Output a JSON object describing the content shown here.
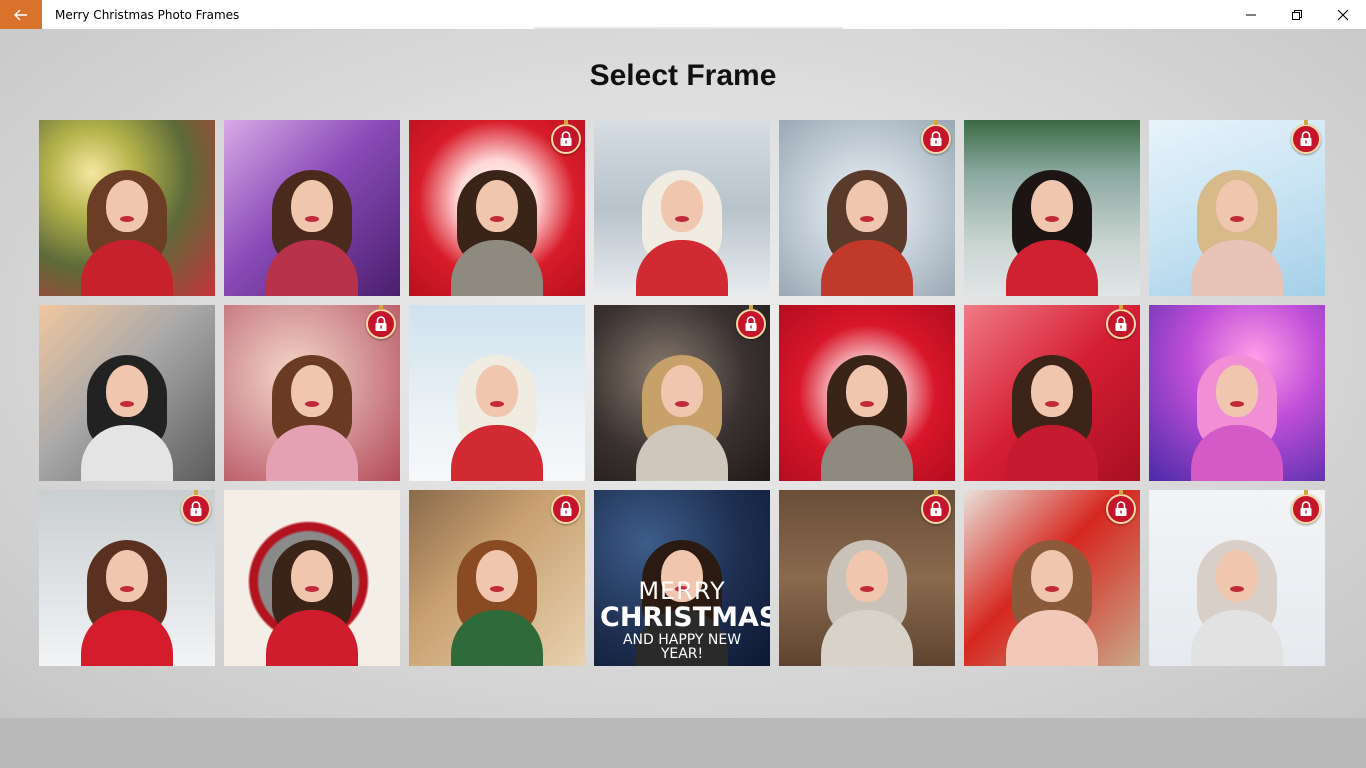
{
  "window": {
    "title": "Merry Christmas Photo Frames",
    "back_icon": "back-arrow-icon",
    "accent": "#d9732c"
  },
  "page": {
    "title": "Select Frame"
  },
  "frames": [
    {
      "id": "frame-1",
      "locked": false,
      "bg": "radial-gradient(circle at 30% 30%, #f6e7a0 0%, #b4b34a 25%, #5d6a3a 55%, #c4343a 100%)",
      "body": "#c8212e",
      "hair": "#6b3d24"
    },
    {
      "id": "frame-2",
      "locked": false,
      "bg": "linear-gradient(135deg, #d9a9e6 0%, #8a4cb8 45%, #4a1e6e 100%)",
      "body": "#b8324a",
      "hair": "#4a2a1c"
    },
    {
      "id": "frame-3",
      "locked": true,
      "bg": "radial-gradient(circle at 50% 45%, #ffffff 0%, #ffd7d7 30%, #d81c2a 60%, #b8101f 100%)",
      "body": "#8f8a80",
      "hair": "#3a2418"
    },
    {
      "id": "frame-4",
      "locked": false,
      "bg": "linear-gradient(180deg, #d6dde3 0%, #b8c3cc 50%, #e8ecef 100%)",
      "body": "#d22a32",
      "hair": "#f1ece2"
    },
    {
      "id": "frame-5",
      "locked": true,
      "bg": "radial-gradient(circle at 50% 50%, #f2f5f8 0%, #c8d3dc 45%, #9aa8b3 100%)",
      "body": "#c0392b",
      "hair": "#5a3a2a"
    },
    {
      "id": "frame-6",
      "locked": false,
      "bg": "linear-gradient(180deg, #3a6a44 0%, #8aa8a0 30%, #c9d4d0 70%, #e0e6e6 100%)",
      "body": "#cf2131",
      "hair": "#1d1414"
    },
    {
      "id": "frame-7",
      "locked": true,
      "bg": "linear-gradient(160deg, #e8f3fb 0%, #c9e4f3 50%, #a5cfe8 100%)",
      "body": "#e8c4b8",
      "hair": "#d7b98a"
    },
    {
      "id": "frame-8",
      "locked": false,
      "bg": "linear-gradient(135deg, #f1c7a0 0%, #a8a8a8 45%, #5c5c5c 100%)",
      "body": "#e4e4e4",
      "hair": "#222222"
    },
    {
      "id": "frame-9",
      "locked": true,
      "bg": "radial-gradient(circle at 40% 40%, #f5d7c8 0%, #d9a0a0 40%, #b34a5a 100%)",
      "body": "#e5a1b4",
      "hair": "#6b3a22"
    },
    {
      "id": "frame-10",
      "locked": false,
      "bg": "linear-gradient(180deg, #cfe2ee 0%, #eaf1f5 60%, #f6f8fa 100%)",
      "body": "#d22a32",
      "hair": "#f1ece2"
    },
    {
      "id": "frame-11",
      "locked": true,
      "bg": "radial-gradient(circle at 40% 40%, #8a7c70 0%, #3a3230 55%, #1e1a18 100%)",
      "body": "#d0c7bc",
      "hair": "#c8a06a"
    },
    {
      "id": "frame-12",
      "locked": false,
      "bg": "radial-gradient(circle at 50% 50%, #ffffff 0%, #ffe8e8 20%, #d8162a 55%, #b20d1f 100%)",
      "body": "#8f8a80",
      "hair": "#3a2418"
    },
    {
      "id": "frame-13",
      "locked": true,
      "bg": "linear-gradient(135deg, #f07b86 0%, #d51e33 50%, #a80f22 100%)",
      "body": "#c51a30",
      "hair": "#3c2418"
    },
    {
      "id": "frame-14",
      "locked": false,
      "bg": "radial-gradient(circle at 60% 30%, #ff9ee8 0%, #c04fd8 40%, #4a2aa8 100%)",
      "body": "#d45ac8",
      "hair": "#f28ed6"
    },
    {
      "id": "frame-15",
      "locked": true,
      "bg": "linear-gradient(180deg, #c9ced1 0%, #dfe3e5 55%, #f2f4f5 100%)",
      "body": "#d41c2c",
      "hair": "#5a3020"
    },
    {
      "id": "frame-16",
      "locked": false,
      "bg": "radial-gradient(circle at 48% 52%, #8a8a8a 0%, #8a8a8a 38%, #b3121f 40%, #b3121f 45%, #f4efe6 47%, #f4efe6 100%)",
      "body": "#d01d2d",
      "hair": "#3a2418"
    },
    {
      "id": "frame-17",
      "locked": true,
      "bg": "linear-gradient(135deg, #8a6a4a 0%, #c8a070 40%, #e8d2b0 100%)",
      "body": "#2e6a3a",
      "hair": "#8a4a22"
    },
    {
      "id": "frame-18",
      "locked": false,
      "bg": "radial-gradient(circle at 30% 30%, #3d5d8a 0%, #1d2e50 55%, #0d1830 100%)",
      "body": "#2a2a2a",
      "hair": "#2a1a12",
      "text": {
        "l1": "MERRY",
        "l2": "CHRISTMAS",
        "l3": "AND HAPPY NEW YEAR!"
      }
    },
    {
      "id": "frame-19",
      "locked": true,
      "bg": "linear-gradient(180deg, #6a4e38 0%, #8a6a4e 50%, #5e4430 100%)",
      "body": "#d8d2c8",
      "hair": "#c8c2b8"
    },
    {
      "id": "frame-20",
      "locked": true,
      "bg": "linear-gradient(135deg, #e8e1da 0%, #d6271f 45%, #c9a98a 100%)",
      "body": "#f2c8b8",
      "hair": "#8a5a3a"
    },
    {
      "id": "frame-21",
      "locked": true,
      "bg": "linear-gradient(180deg, #f2f4f6 0%, #e6eaee 100%)",
      "body": "#e2e2e2",
      "hair": "#d8d0c8"
    }
  ],
  "icons": {
    "lock": "lock-icon",
    "minimize": "minimize-icon",
    "restore": "restore-icon",
    "close": "close-icon"
  }
}
